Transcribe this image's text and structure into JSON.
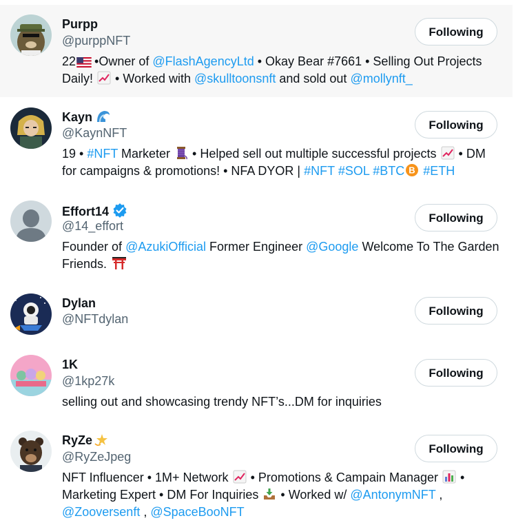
{
  "following_label": "Following",
  "users": [
    {
      "name": "Purpp",
      "handle": "@purppNFT",
      "bio": [
        {
          "t": "22"
        },
        {
          "emoji": "us-flag-icon"
        },
        {
          "t": " •Owner of "
        },
        {
          "t": "@FlashAgencyLtd",
          "link": true
        },
        {
          "t": " • Okay Bear #7661 • Selling Out Projects Daily! "
        },
        {
          "emoji": "chart-increasing-icon"
        },
        {
          "t": " • Worked with "
        },
        {
          "t": "@skulltoonsnft",
          "link": true
        },
        {
          "t": " and sold out "
        },
        {
          "t": "@mollynft_",
          "link": true
        }
      ]
    },
    {
      "name": "Kayn",
      "name_badge": "wave-emoji-icon",
      "handle": "@KaynNFT",
      "bio": [
        {
          "t": "19 • "
        },
        {
          "t": "#NFT",
          "link": true
        },
        {
          "t": " Marketer "
        },
        {
          "emoji": "spool-of-thread-icon"
        },
        {
          "t": " • Helped sell out multiple successful projects "
        },
        {
          "emoji": "chart-increasing-icon"
        },
        {
          "t": " • DM for campaigns & promotions! • NFA DYOR | "
        },
        {
          "t": "#NFT",
          "link": true
        },
        {
          "t": " "
        },
        {
          "t": "#SOL",
          "link": true
        },
        {
          "t": " "
        },
        {
          "t": "#BTC",
          "link": true
        },
        {
          "emoji": "bitcoin-icon"
        },
        {
          "t": " "
        },
        {
          "t": "#ETH",
          "link": true
        }
      ]
    },
    {
      "name": "Effort14",
      "name_badge": "verified-badge-icon",
      "handle": "@14_effort",
      "bio": [
        {
          "t": "Founder of "
        },
        {
          "t": "@AzukiOfficial",
          "link": true
        },
        {
          "t": " Former Engineer "
        },
        {
          "t": "@Google",
          "link": true
        },
        {
          "t": " Welcome To The Garden Friends. "
        },
        {
          "emoji": "torii-gate-icon"
        }
      ]
    },
    {
      "name": "Dylan",
      "handle": "@NFTdylan",
      "bio": []
    },
    {
      "name": "1K",
      "handle": "@1kp27k",
      "bio": [
        {
          "t": "selling out and showcasing trendy NFT’s...DM for inquiries"
        }
      ]
    },
    {
      "name": "RyZe",
      "name_badge": "dizzy-star-icon",
      "handle": "@RyZeJpeg",
      "bio": [
        {
          "t": "NFT Influencer • 1M+ Network "
        },
        {
          "emoji": "chart-increasing-icon"
        },
        {
          "t": " • Promotions & Campain Manager "
        },
        {
          "emoji": "bar-chart-icon"
        },
        {
          "t": " • Marketing Expert • DM For Inquiries "
        },
        {
          "emoji": "inbox-tray-icon"
        },
        {
          "t": " • Worked w/ "
        },
        {
          "t": "@AntonymNFT",
          "link": true
        },
        {
          "t": " , "
        },
        {
          "t": "@Zooversenft",
          "link": true
        },
        {
          "t": " , "
        },
        {
          "t": "@SpaceBooNFT",
          "link": true
        }
      ]
    }
  ],
  "colors": {
    "link": "#1d9bf0",
    "secondary_text": "#536471",
    "hover_row": "#f7f7f7",
    "verified": "#1d9bf0"
  }
}
